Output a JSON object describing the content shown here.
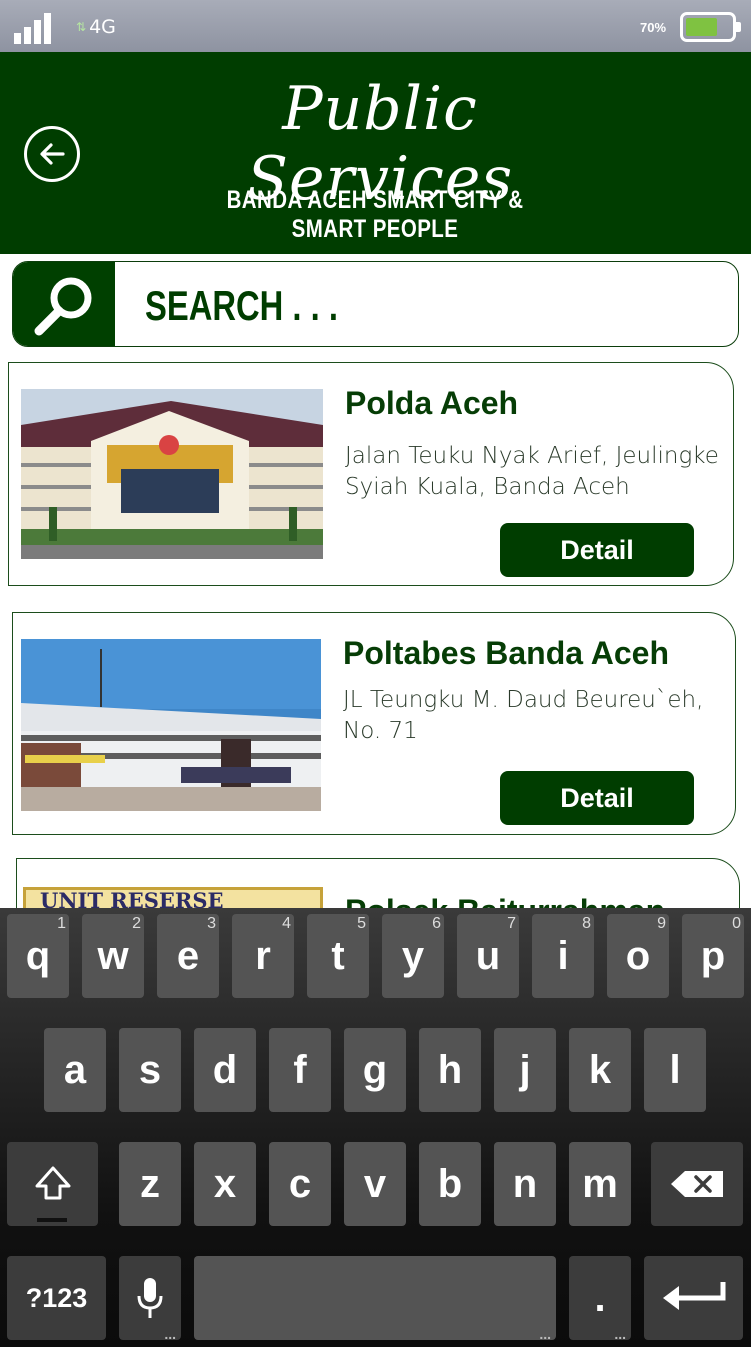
{
  "status_bar": {
    "network": "4G",
    "battery": "70%",
    "battery_level": 0.7
  },
  "header": {
    "title": "Public Services",
    "subtitle": "BANDA ACEH SMART CITY & SMART PEOPLE"
  },
  "search": {
    "placeholder": "SEARCH . . ."
  },
  "cards": [
    {
      "name": "Polda Aceh",
      "address": "Jalan Teuku Nyak Arief, Jeulingke Syiah Kuala, Banda Aceh",
      "button": "Detail"
    },
    {
      "name": "Poltabes Banda Aceh",
      "address": "JL Teungku M. Daud Beureu`eh, No. 71",
      "button": "Detail"
    },
    {
      "name": "Polsek Baiturrahman",
      "image_text": "UNIT RESERSE"
    }
  ],
  "keyboard": {
    "row1": [
      {
        "k": "q",
        "h": "1"
      },
      {
        "k": "w",
        "h": "2"
      },
      {
        "k": "e",
        "h": "3"
      },
      {
        "k": "r",
        "h": "4"
      },
      {
        "k": "t",
        "h": "5"
      },
      {
        "k": "y",
        "h": "6"
      },
      {
        "k": "u",
        "h": "7"
      },
      {
        "k": "i",
        "h": "8"
      },
      {
        "k": "o",
        "h": "9"
      },
      {
        "k": "p",
        "h": "0"
      }
    ],
    "row2": [
      "a",
      "s",
      "d",
      "f",
      "g",
      "h",
      "j",
      "k",
      "l"
    ],
    "row3": [
      "z",
      "x",
      "c",
      "v",
      "b",
      "n",
      "m"
    ],
    "symbols": "?123",
    "period": "."
  },
  "colors": {
    "brand": "#003d00",
    "accent": "#7fc241"
  }
}
